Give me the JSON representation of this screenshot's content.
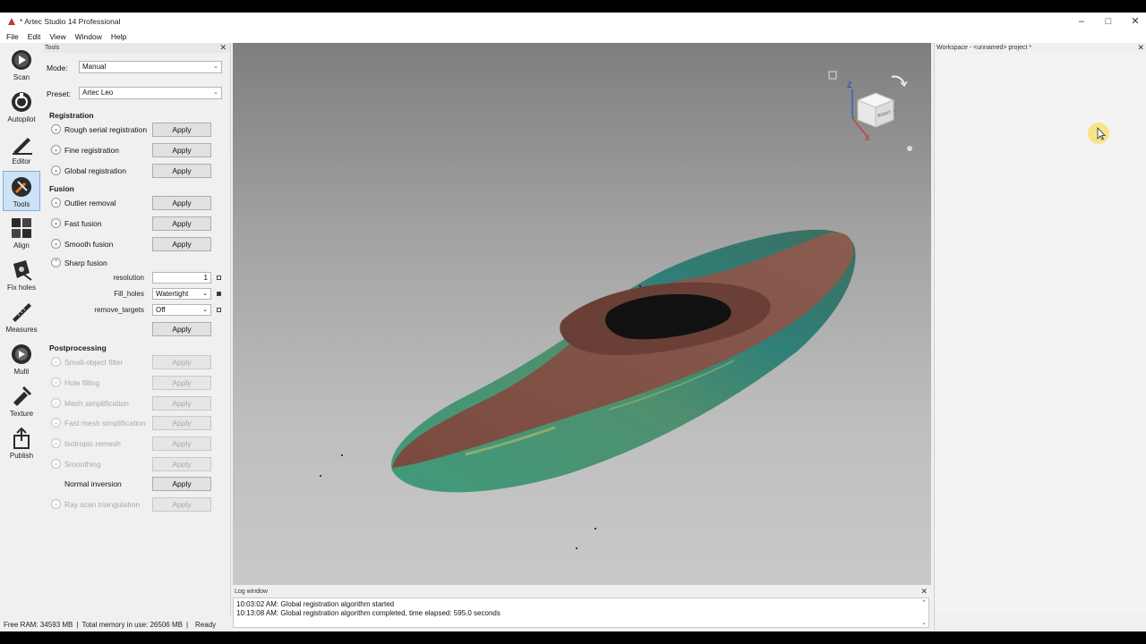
{
  "window": {
    "title": "* Artec Studio 14 Professional",
    "minimize": "–",
    "maximize": "□",
    "close": "✕"
  },
  "menu": [
    "File",
    "Edit",
    "View",
    "Window",
    "Help"
  ],
  "toolbar": [
    {
      "label": "Scan",
      "icon": "scan-icon",
      "active": false
    },
    {
      "label": "Autopilot",
      "icon": "autopilot-icon",
      "active": false
    },
    {
      "label": "Editor",
      "icon": "editor-icon",
      "active": false
    },
    {
      "label": "Tools",
      "icon": "tools-icon",
      "active": true
    },
    {
      "label": "Align",
      "icon": "align-icon",
      "active": false
    },
    {
      "label": "Fix holes",
      "icon": "fix-holes-icon",
      "active": false
    },
    {
      "label": "Measures",
      "icon": "measures-icon",
      "active": false
    },
    {
      "label": "Multi",
      "icon": "multi-icon",
      "active": false
    },
    {
      "label": "Texture",
      "icon": "texture-icon",
      "active": false
    },
    {
      "label": "Publish",
      "icon": "publish-icon",
      "active": false
    }
  ],
  "tools_panel": {
    "title": "Tools",
    "close": "✕",
    "mode_label": "Mode:",
    "mode_value": "Manual",
    "preset_label": "Preset:",
    "preset_value": "Artec Leo",
    "apply_label": "Apply",
    "sections": {
      "registration": "Registration",
      "fusion": "Fusion",
      "postprocessing": "Postprocessing"
    },
    "registration_tools": [
      "Rough serial registration",
      "Fine registration",
      "Global registration"
    ],
    "fusion_tools": [
      "Outlier removal",
      "Fast fusion",
      "Smooth fusion"
    ],
    "sharp_fusion": {
      "name": "Sharp fusion",
      "params": [
        {
          "label": "resolution",
          "value": "1"
        },
        {
          "label": "Fill_holes",
          "value": "Watertight"
        },
        {
          "label": "remove_targets",
          "value": "Off"
        }
      ]
    },
    "postprocessing_tools": [
      {
        "name": "Small-object filter",
        "enabled": false
      },
      {
        "name": "Hole filling",
        "enabled": false
      },
      {
        "name": "Mesh simplification",
        "enabled": false
      },
      {
        "name": "Fast mesh simplification",
        "enabled": false
      },
      {
        "name": "Isotropic remesh",
        "enabled": false
      },
      {
        "name": "Smoothing",
        "enabled": false
      },
      {
        "name": "Normal inversion",
        "enabled": true
      },
      {
        "name": "Ray scan triangulation",
        "enabled": false
      }
    ]
  },
  "viewcube": {
    "face_label": "RIGHT",
    "axis_z": "Z",
    "axis_x": "X"
  },
  "log_window": {
    "title": "Log window",
    "lines": [
      "10:03:02 AM: Global registration algorithm started",
      "10:13:08 AM: Global registration algorithm completed, time elapsed: 595.0 seconds"
    ]
  },
  "workspace": {
    "title": "Workspace - <unnamed> project *"
  },
  "status": {
    "free_ram": "Free RAM: 34593 MB",
    "total_memory": "Total memory in use: 26506 MB",
    "state": "Ready"
  },
  "colors": {
    "accent": "#cde2f5",
    "mesh_brown": "#7a4a3e",
    "mesh_green": "#3f9a7a"
  }
}
